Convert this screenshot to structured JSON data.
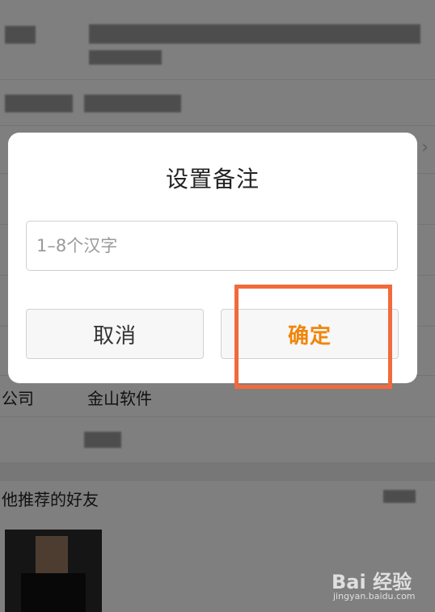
{
  "background": {
    "company_label": "公司",
    "company_value": "金山软件",
    "section_title_partial": "他推荐的好友"
  },
  "dialog": {
    "title": "设置备注",
    "input_placeholder": "1–8个汉字",
    "input_value": "",
    "cancel_label": "取消",
    "confirm_label": "确定"
  },
  "watermark": {
    "logo": "Bai 经验",
    "url": "jingyan.baidu.com"
  },
  "colors": {
    "accent": "#f0860b",
    "highlight": "#f26a3c",
    "overlay": "rgba(0,0,0,0.5)"
  }
}
